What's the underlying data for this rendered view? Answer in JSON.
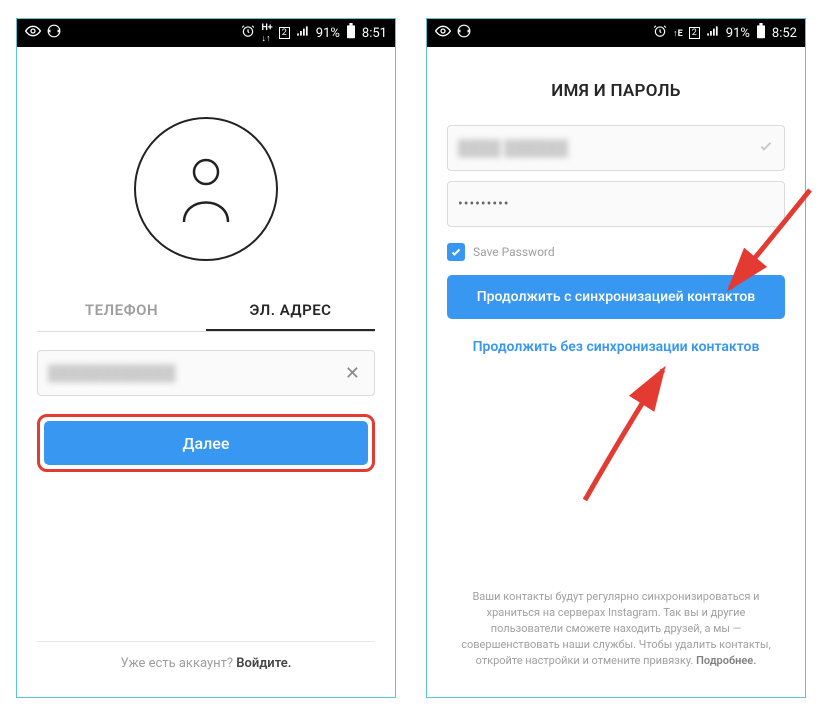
{
  "left": {
    "statusbar": {
      "battery": "91%",
      "time": "8:51"
    },
    "tabs": {
      "phone": "ТЕЛЕФОН",
      "email": "ЭЛ. АДРЕС"
    },
    "email_input": {
      "clear": "✕"
    },
    "next_button": "Далее",
    "footer": {
      "prefix": "Уже есть аккаунт? ",
      "login": "Войдите."
    }
  },
  "right": {
    "statusbar": {
      "battery": "91%",
      "time": "8:52"
    },
    "title": "ИМЯ И ПАРОЛЬ",
    "password_mask": "•••••••••",
    "save_password_label": "Save Password",
    "continue_sync": "Продолжить с синхронизацией контактов",
    "continue_nosync": "Продолжить без синхронизации контактов",
    "disclaimer_text": "Ваши контакты будут регулярно синхронизироваться и храниться на серверах Instagram. Так вы и другие пользователи сможете находить друзей, а мы — совершенствовать наши службы. Чтобы удалить контакты, откройте настройки и отмените привязку. ",
    "disclaimer_more": "Подробнее."
  }
}
